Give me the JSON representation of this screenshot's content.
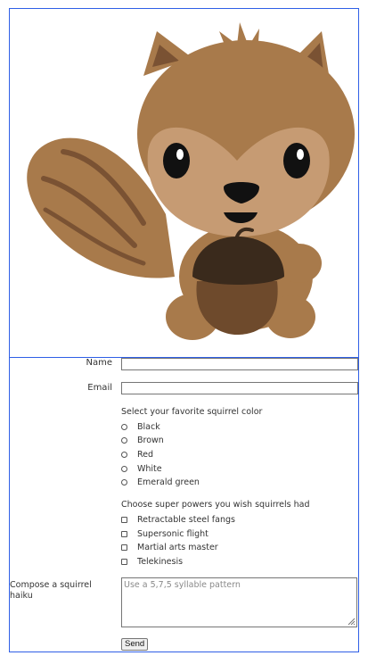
{
  "form": {
    "name_label": "Name",
    "email_label": "Email",
    "color_question": "Select your favorite squirrel color",
    "colors": [
      "Black",
      "Brown",
      "Red",
      "White",
      "Emerald green"
    ],
    "powers_question": "Choose super powers you wish squirrels had",
    "powers": [
      "Retractable steel fangs",
      "Supersonic flight",
      "Martial arts master",
      "Telekinesis"
    ],
    "haiku_label": "Compose a squirrel haiku",
    "haiku_placeholder": "Use a 5,7,5 syllable pattern",
    "send_label": "Send"
  },
  "colors": {
    "border": "#2f5fe6",
    "fur": "#a87a4b",
    "face": "#c69b73",
    "tail_stripe": "#7a5233",
    "acorn_cap": "#3a2a1c",
    "acorn_body": "#6e4a2c"
  }
}
